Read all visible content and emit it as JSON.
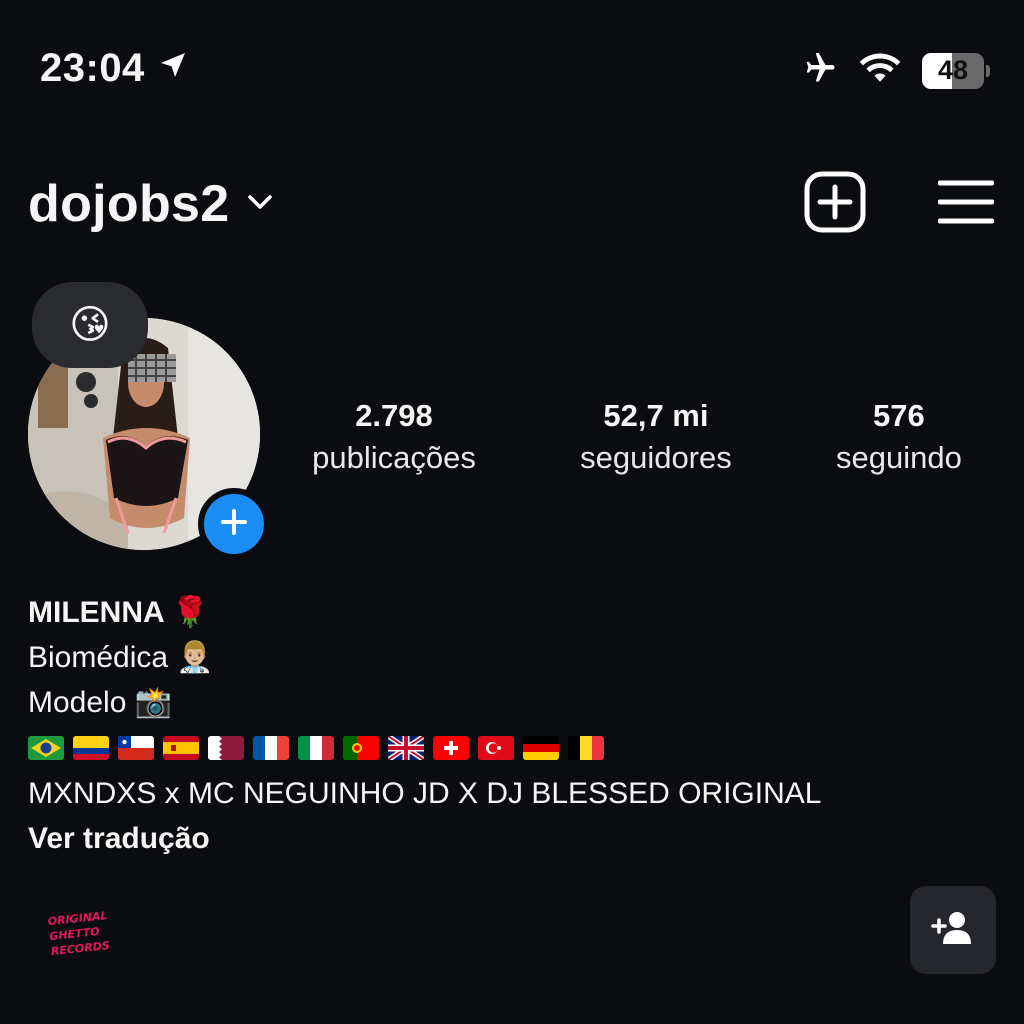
{
  "status_bar": {
    "time": "23:04",
    "battery_text": "48",
    "battery_level": 0.48,
    "icons": [
      "location-arrow-icon",
      "airplane-icon",
      "wifi-icon",
      "battery-icon"
    ]
  },
  "header": {
    "username": "dojobs2",
    "icons": [
      "chevron-down-icon",
      "new-post-icon",
      "menu-icon"
    ]
  },
  "profile": {
    "note_emoji": "😘",
    "stats": [
      {
        "value": "2.798",
        "label": "publicações"
      },
      {
        "value": "52,7 mi",
        "label": "seguidores"
      },
      {
        "value": "576",
        "label": "seguindo"
      }
    ]
  },
  "bio": {
    "name": "MILENNA 🌹",
    "line1": "Biomédica 👨🏼‍⚕️",
    "line2": "Modelo 📸",
    "flags": [
      "brazil",
      "colombia",
      "chile",
      "spain",
      "qatar",
      "france",
      "italy",
      "portugal",
      "uk",
      "switzerland",
      "turkey",
      "germany",
      "belgium"
    ],
    "credits": "MXNDXS x MC NEGUINHO JD X DJ BLESSED ORIGINAL",
    "translate_link": "Ver tradução"
  },
  "footer": {
    "watermark": "ORIGINAL GHETTO RECORDS"
  },
  "colors": {
    "background": "#0b0c10",
    "accent_blue": "#1a8ef5",
    "watermark_pink": "#e0185a"
  }
}
